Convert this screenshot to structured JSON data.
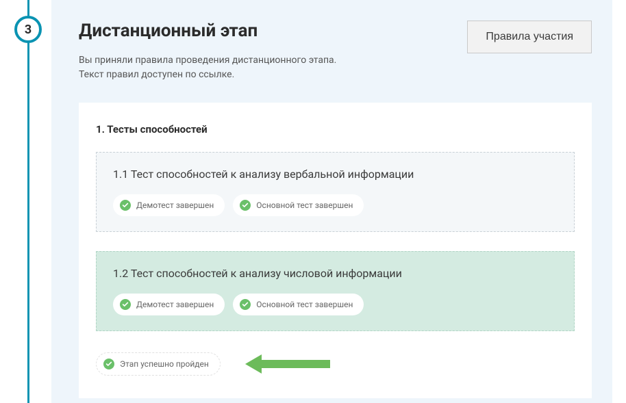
{
  "step": {
    "number": "3"
  },
  "header": {
    "title": "Дистанционный этап",
    "rules_button": "Правила участия",
    "subtitle_line1": "Вы приняли правила проведения дистанционного этапа.",
    "subtitle_line2": "Текст правил доступен по ссылке."
  },
  "section": {
    "title": "1. Тесты способностей"
  },
  "tests": {
    "test1": {
      "title": "1.1 Тест способностей к анализу вербальной информации",
      "demo_label": "Демотест завершен",
      "main_label": "Основной тест завершен"
    },
    "test2": {
      "title": "1.2 Тест способностей к анализу числовой информации",
      "demo_label": "Демотест завершен",
      "main_label": "Основной тест завершен"
    }
  },
  "final_status": {
    "label": "Этап успешно пройден"
  },
  "colors": {
    "accent": "#0a93b2",
    "success": "#6ac069",
    "arrow": "#6cbb5a"
  }
}
